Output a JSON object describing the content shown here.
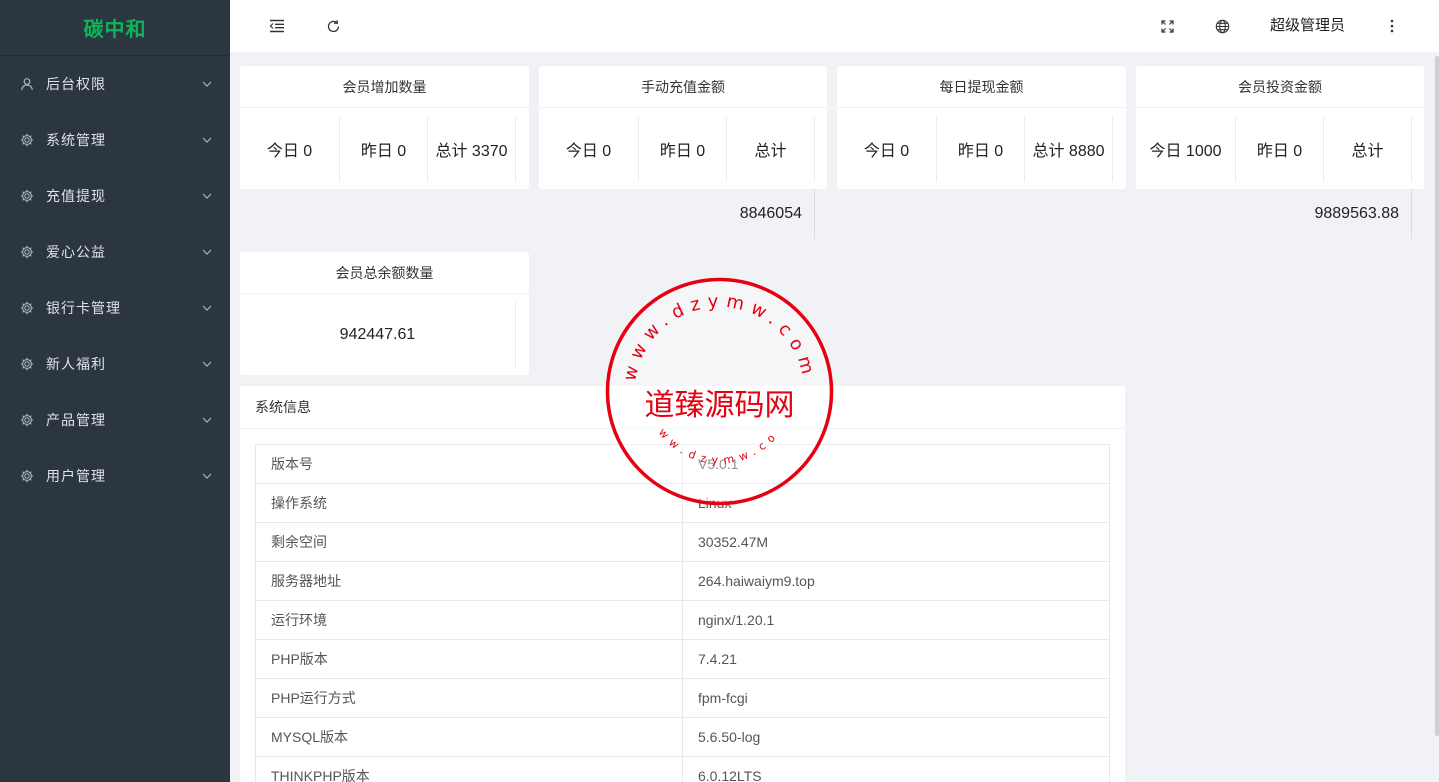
{
  "app": {
    "brand": "碳中和"
  },
  "sidebar": {
    "items": [
      {
        "label": "后台权限",
        "icon": "user-icon"
      },
      {
        "label": "系统管理",
        "icon": "gear-icon"
      },
      {
        "label": "充值提现",
        "icon": "gear-icon"
      },
      {
        "label": "爱心公益",
        "icon": "gear-icon"
      },
      {
        "label": "银行卡管理",
        "icon": "gear-icon"
      },
      {
        "label": "新人福利",
        "icon": "gear-icon"
      },
      {
        "label": "产品管理",
        "icon": "gear-icon"
      },
      {
        "label": "用户管理",
        "icon": "gear-icon"
      }
    ]
  },
  "header": {
    "icons": [
      "menu-fold-icon",
      "refresh-icon",
      "fullscreen-icon",
      "globe-icon",
      "more-vertical-icon"
    ],
    "admin_name": "超级管理员"
  },
  "stats": [
    {
      "title": "会员增加数量",
      "today": "今日 0",
      "yesterday": "昨日 0",
      "total": "总计 3370"
    },
    {
      "title": "手动充值金额",
      "today": "今日 0",
      "yesterday": "昨日 0",
      "total": "总计",
      "total_value": "8846054"
    },
    {
      "title": "每日提现金额",
      "today": "今日 0",
      "yesterday": "昨日 0",
      "total": "总计 8880"
    },
    {
      "title": "会员投资金额",
      "today": "今日 1000",
      "yesterday": "昨日 0",
      "total": "总计",
      "total_value": "9889563.88"
    }
  ],
  "balance": {
    "title": "会员总余额数量",
    "value": "942447.61"
  },
  "sysinfo": {
    "title": "系统信息",
    "rows": [
      {
        "key": "版本号",
        "value": "V5.0.1"
      },
      {
        "key": "操作系统",
        "value": "Linux"
      },
      {
        "key": "剩余空间",
        "value": "30352.47M"
      },
      {
        "key": "服务器地址",
        "value": "264.haiwaiym9.top"
      },
      {
        "key": "运行环境",
        "value": "nginx/1.20.1"
      },
      {
        "key": "PHP版本",
        "value": "7.4.21"
      },
      {
        "key": "PHP运行方式",
        "value": "fpm-fcgi"
      },
      {
        "key": "MYSQL版本",
        "value": "5.6.50-log"
      },
      {
        "key": "THINKPHP版本",
        "value": "6.0.12LTS"
      }
    ]
  },
  "watermark": {
    "main_text": "道臻源码网",
    "ring_text": "www.dzymw.com"
  },
  "colors": {
    "sidebar_bg": "#2b3640",
    "brand": "#0db45a",
    "stamp_red": "#e60012"
  }
}
